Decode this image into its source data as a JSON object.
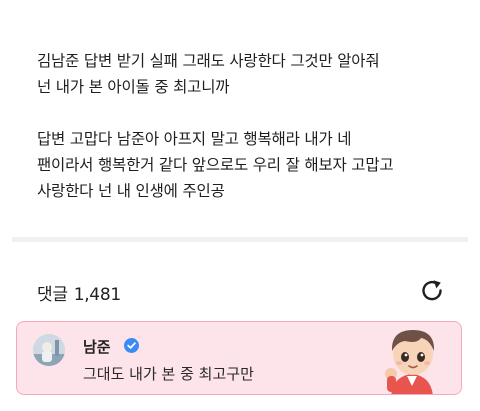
{
  "post": {
    "paragraphs": [
      "김남준 답변 받기 실패 그래도 사랑한다 그것만 알아줘\n넌 내가 본 아이돌 중 최고니까",
      "답변 고맙다 남준아 아프지 말고 행복해라 내가 네\n팬이라서 행복한거 같다 앞으로도 우리 잘 해보자 고맙고\n사랑한다 넌 내 인생에 주인공"
    ]
  },
  "comments": {
    "label": "댓글",
    "count": "1,481",
    "refresh_icon": "refresh-icon"
  },
  "artist_comment": {
    "author": "남준",
    "verified_icon": "verified-badge-icon",
    "text": "그대도 내가 본 중 최고구만",
    "background": "#fde4ea",
    "border": "#f4a9bd",
    "badge_color": "#3d8af7"
  }
}
